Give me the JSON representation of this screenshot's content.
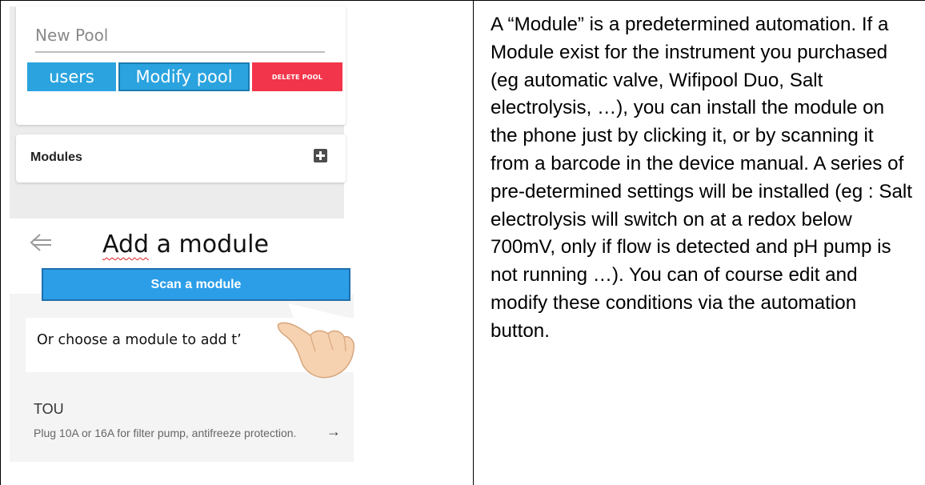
{
  "pool": {
    "name_value": "New Pool",
    "users_button": "users",
    "modify_button": "Modify pool",
    "delete_button": "DELETE POOL"
  },
  "modules": {
    "label": "Modules",
    "add_icon": "plus-square-icon"
  },
  "add_module": {
    "back_icon": "back-arrow-icon",
    "title_word1": "Add",
    "title_rest": " a module",
    "scan_button": "Scan a module",
    "choose_pre": "Or ",
    "choose_word": "choose",
    "choose_mid": " a module to ",
    "choose_word2": "add",
    "choose_tail": " t’",
    "hand_icon": "pointing-hand-icon",
    "item": {
      "title": "TOU",
      "description": "Plug 10A or 16A for filter pump, antifreeze protection.",
      "arrow_icon": "arrow-right-icon"
    }
  },
  "description": "A “Module” is a predetermined automation. If a Module exist for the instrument you purchased (eg automatic valve, Wifipool Duo, Salt electrolysis, …), you can install the module on the phone just by clicking it, or by scanning it from a barcode in the device manual. A series of pre-determined settings will be installed (eg : Salt electrolysis will switch on at a redox below 700mV, only if flow is detected and pH pump is not running …). You can of course edit and modify these conditions via the automation button.",
  "colors": {
    "button_blue": "#2aa3df",
    "delete_red": "#f2354a",
    "scan_blue": "#2c9ee8"
  }
}
